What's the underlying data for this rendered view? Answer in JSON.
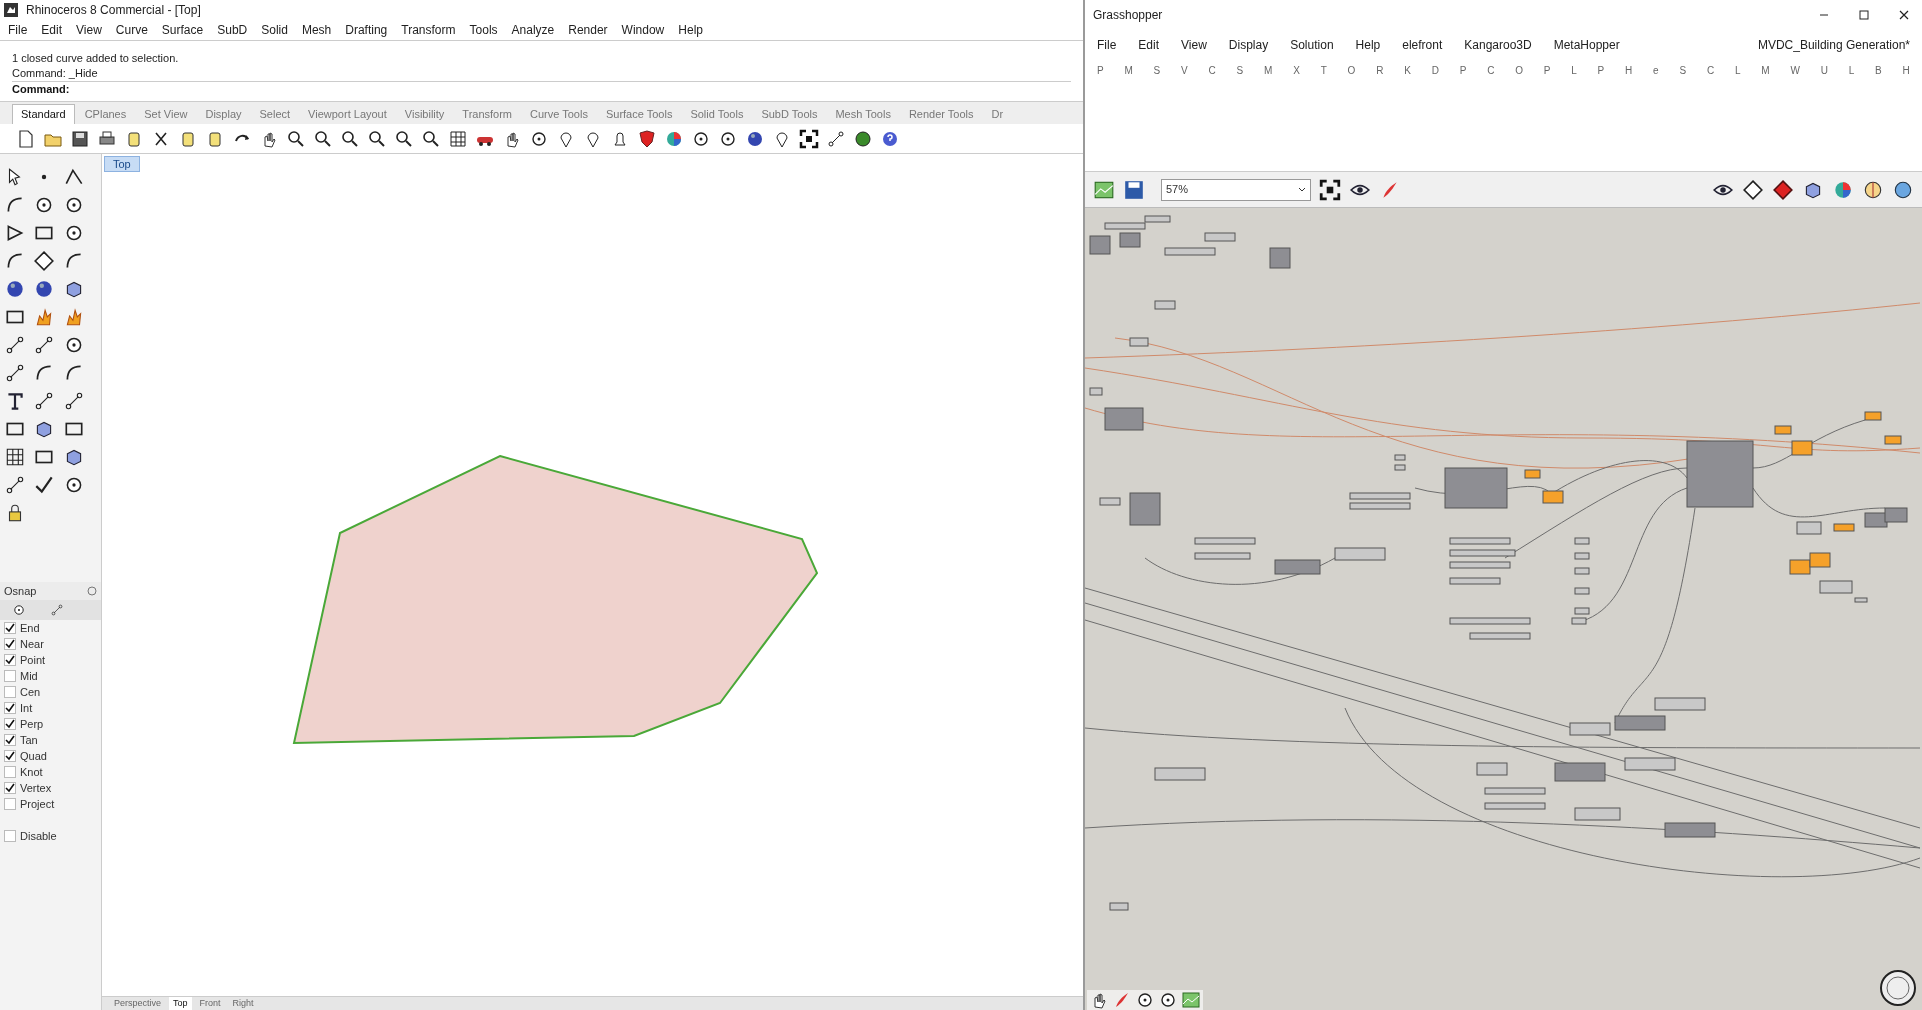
{
  "rhino": {
    "title": "Rhinoceros 8 Commercial - [Top]",
    "menu": [
      "File",
      "Edit",
      "View",
      "Curve",
      "Surface",
      "SubD",
      "Solid",
      "Mesh",
      "Drafting",
      "Transform",
      "Tools",
      "Analyze",
      "Render",
      "Window",
      "Help"
    ],
    "command_history": [
      "1 closed curve added to selection.",
      "Command: _Hide"
    ],
    "command_prompt": "Command:",
    "toolbar_tabs": [
      {
        "label": "Standard",
        "selected": true
      },
      {
        "label": "CPlanes",
        "selected": false
      },
      {
        "label": "Set View",
        "selected": false
      },
      {
        "label": "Display",
        "selected": false
      },
      {
        "label": "Select",
        "selected": false
      },
      {
        "label": "Viewport Layout",
        "selected": false
      },
      {
        "label": "Visibility",
        "selected": false
      },
      {
        "label": "Transform",
        "selected": false
      },
      {
        "label": "Curve Tools",
        "selected": false
      },
      {
        "label": "Surface Tools",
        "selected": false
      },
      {
        "label": "Solid Tools",
        "selected": false
      },
      {
        "label": "SubD Tools",
        "selected": false
      },
      {
        "label": "Mesh Tools",
        "selected": false
      },
      {
        "label": "Render Tools",
        "selected": false
      },
      {
        "label": "Dr",
        "selected": false
      }
    ],
    "viewport_label": "Top",
    "osnap": {
      "title": "Osnap",
      "items": [
        {
          "label": "End",
          "checked": true
        },
        {
          "label": "Near",
          "checked": true
        },
        {
          "label": "Point",
          "checked": true
        },
        {
          "label": "Mid",
          "checked": false
        },
        {
          "label": "Cen",
          "checked": false
        },
        {
          "label": "Int",
          "checked": true
        },
        {
          "label": "Perp",
          "checked": true
        },
        {
          "label": "Tan",
          "checked": true
        },
        {
          "label": "Quad",
          "checked": true
        },
        {
          "label": "Knot",
          "checked": false
        },
        {
          "label": "Vertex",
          "checked": true
        },
        {
          "label": "Project",
          "checked": false
        }
      ],
      "disable": {
        "label": "Disable",
        "checked": false
      }
    },
    "viewport_tabs": [
      {
        "label": "Perspective",
        "selected": false
      },
      {
        "label": "Top",
        "selected": true
      },
      {
        "label": "Front",
        "selected": false
      },
      {
        "label": "Right",
        "selected": false
      }
    ]
  },
  "grasshopper": {
    "title": "Grasshopper",
    "menu": [
      "File",
      "Edit",
      "View",
      "Display",
      "Solution",
      "Help",
      "elefront",
      "Kangaroo3D",
      "MetaHopper"
    ],
    "document": "MVDC_Building Generation*",
    "component_tabs": [
      "P",
      "M",
      "S",
      "V",
      "C",
      "S",
      "M",
      "X",
      "T",
      "O",
      "R",
      "K",
      "D",
      "P",
      "C",
      "O",
      "P",
      "L",
      "P",
      "H",
      "e",
      "S",
      "C",
      "L",
      "M",
      "W",
      "U",
      "L",
      "B",
      "H"
    ],
    "zoom": "57%"
  }
}
